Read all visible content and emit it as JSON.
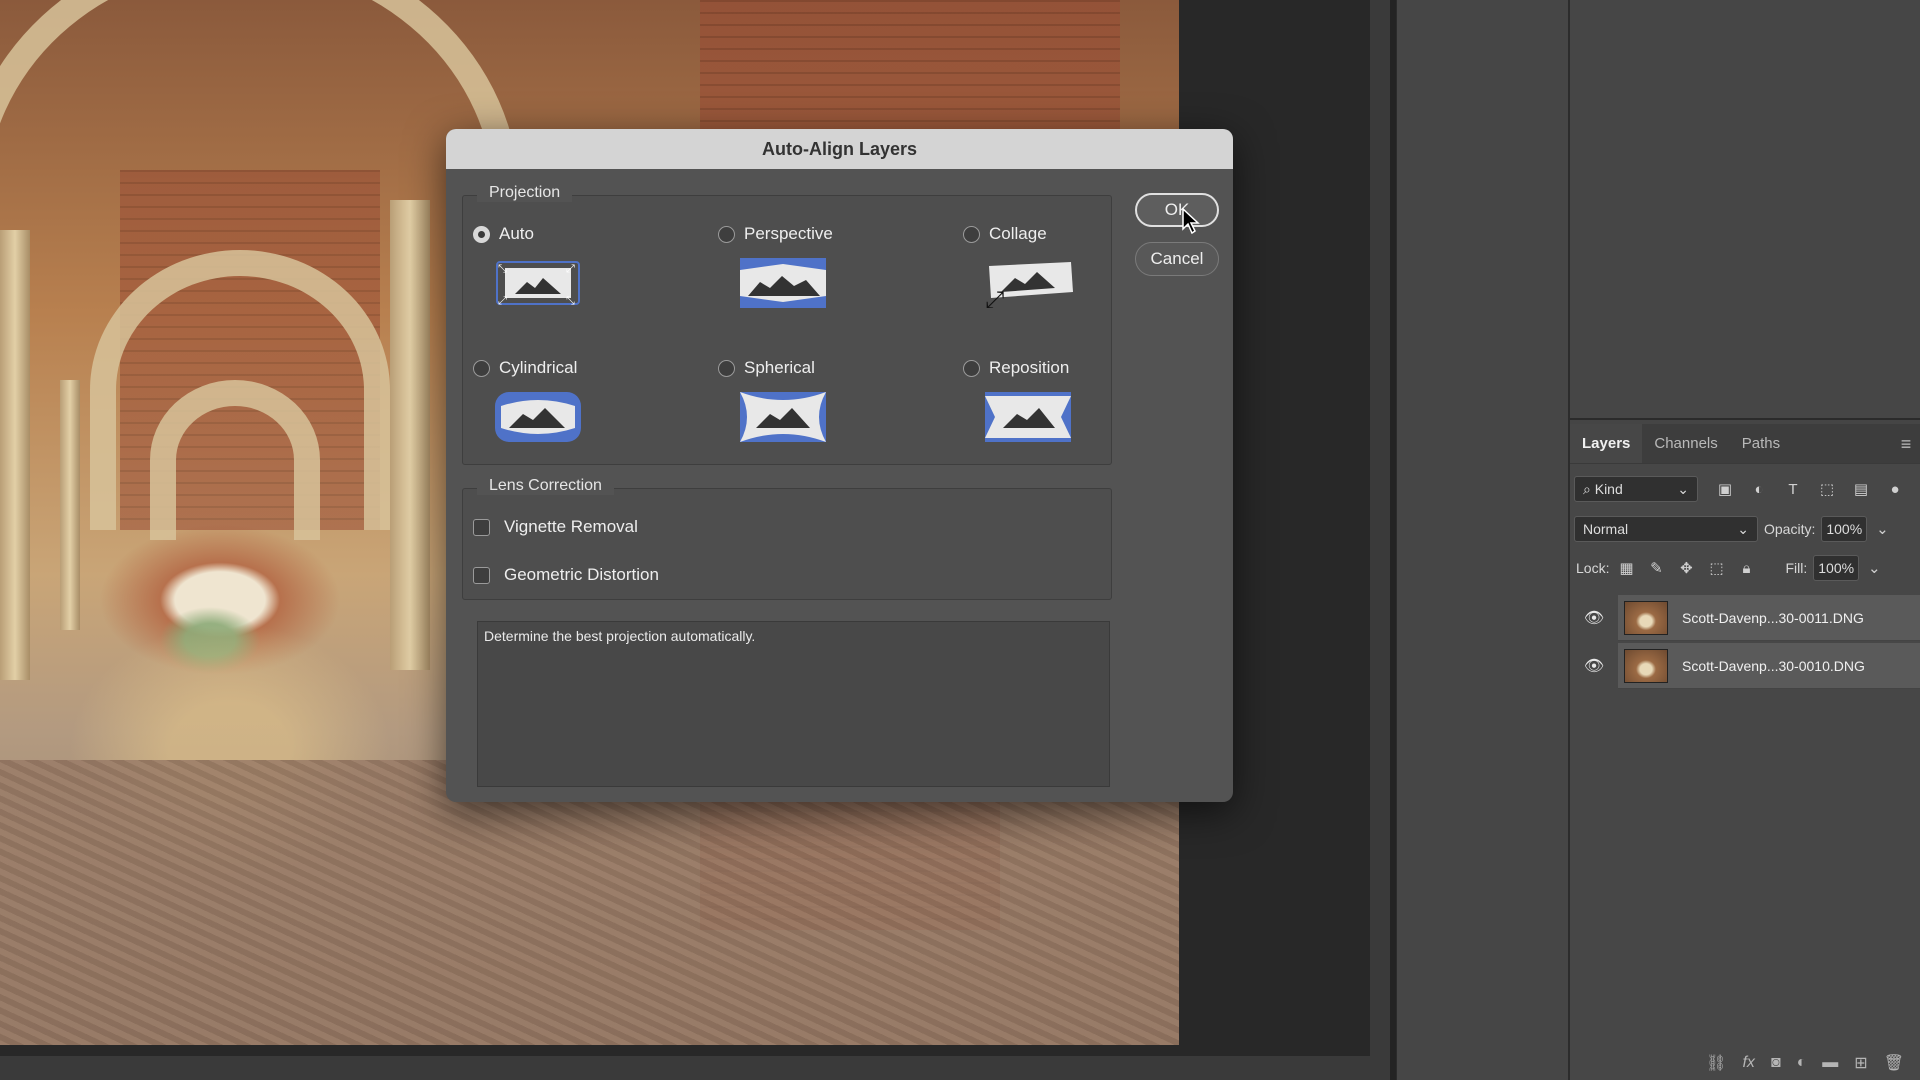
{
  "dialog": {
    "title": "Auto-Align Layers",
    "projection_legend": "Projection",
    "options": [
      {
        "label": "Auto",
        "selected": true
      },
      {
        "label": "Perspective",
        "selected": false
      },
      {
        "label": "Collage",
        "selected": false
      },
      {
        "label": "Cylindrical",
        "selected": false
      },
      {
        "label": "Spherical",
        "selected": false
      },
      {
        "label": "Reposition",
        "selected": false
      }
    ],
    "lens_legend": "Lens Correction",
    "vignette_label": "Vignette Removal",
    "distortion_label": "Geometric Distortion",
    "description": "Determine the best projection automatically.",
    "ok_label": "OK",
    "cancel_label": "Cancel",
    "accent_color": "#4f72c8"
  },
  "layers_panel": {
    "tabs": [
      "Layers",
      "Channels",
      "Paths"
    ],
    "filter_kind": "Kind",
    "blend_mode": "Normal",
    "opacity_label": "Opacity:",
    "opacity_value": "100%",
    "lock_label": "Lock:",
    "fill_label": "Fill:",
    "fill_value": "100%",
    "layers": [
      {
        "name": "Scott-Davenp...30-0011.DNG",
        "visible": true
      },
      {
        "name": "Scott-Davenp...30-0010.DNG",
        "visible": true
      }
    ]
  }
}
